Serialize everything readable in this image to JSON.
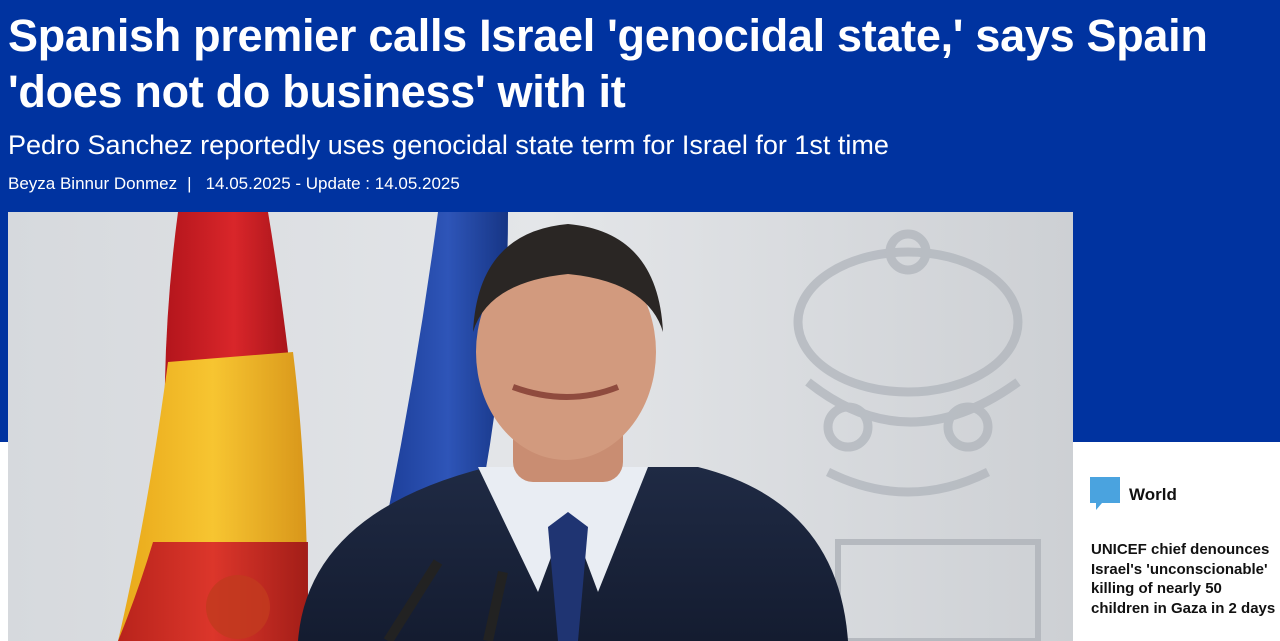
{
  "article": {
    "headline": "Spanish premier calls Israel 'genocidal state,' says Spain 'does not do business' with it",
    "subtitle": "Pedro Sanchez reportedly uses genocidal state term for Israel for 1st time",
    "author": "Beyza Binnur Donmez",
    "separator": "|",
    "dates": "14.05.2025 - Update : 14.05.2025",
    "photo_icon": "press-conference-photo"
  },
  "sidebar": {
    "category_icon": "speech-bubble-icon",
    "category": "World",
    "related_headline": "UNICEF chief denounces Israel's 'unconscionable' killing of nearly 50 children in Gaza in 2 days"
  },
  "colors": {
    "hero_background": "#0033a0",
    "category_icon": "#4aa3df",
    "headline_text": "#ffffff",
    "sidebar_text": "#111111"
  }
}
